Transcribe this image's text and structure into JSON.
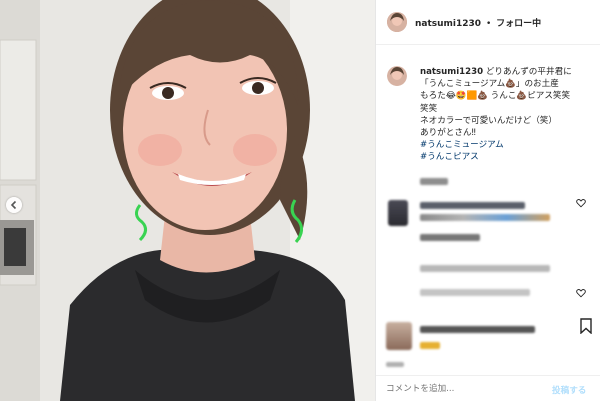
{
  "post": {
    "username": "natsumi1230",
    "separator": "•",
    "follow_status": "フォロー中"
  },
  "caption": {
    "username": "natsumi1230",
    "line1": "どりあんずの平井君に",
    "line2": "「うんこミュージアム💩」のお土産",
    "line3": "もろた😂🤩🟧💩 うんこ💩ピアス笑笑",
    "line4": "笑笑",
    "line5": "ネオカラーで可愛いんだけど（笑）",
    "line6": "ありがとさん‼︎",
    "hashtag1": "#うんこミュージアム",
    "hashtag2": "#うんこピアス"
  },
  "comment_box": {
    "placeholder": "コメントを追加...",
    "post_label": "投稿する"
  },
  "colors": {
    "link": "#00376b",
    "post_button": "#b2dffc",
    "earring": "#39d352"
  }
}
